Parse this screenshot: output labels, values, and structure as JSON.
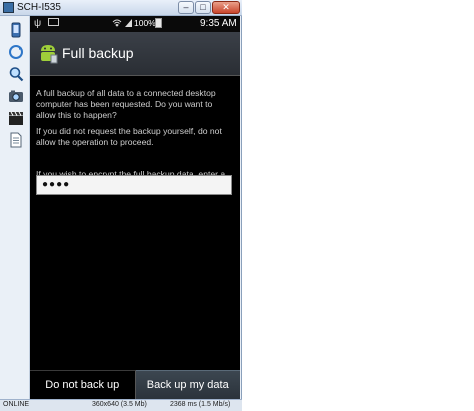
{
  "window": {
    "title": "SCH-I535",
    "minimize_label": "–",
    "maximize_label": "□",
    "close_label": "✕"
  },
  "tools": [
    {
      "name": "phone-icon"
    },
    {
      "name": "rotate-icon"
    },
    {
      "name": "zoom-icon"
    },
    {
      "name": "camera-icon"
    },
    {
      "name": "video-clapper-icon"
    },
    {
      "name": "document-icon"
    }
  ],
  "statusbar": {
    "battery_percent": "100%",
    "time": "9:35 AM"
  },
  "actionbar": {
    "title": "Full backup"
  },
  "content": {
    "paragraph1": "A full backup of all data to a connected desktop computer has been requested. Do you want to allow this to happen?",
    "paragraph2": "If you did not request the backup yourself, do not allow the operation to proceed.",
    "paragraph3": "If you wish to encrypt the full backup data, enter a password below:",
    "password_value": "●●●●"
  },
  "buttons": {
    "deny_label": "Do not back up",
    "confirm_label": "Back up my data"
  },
  "bottombar": {
    "status": "ONLINE",
    "resolution": "360x640 (3.5 Mb)",
    "timing": "2368 ms (1.5 Mb/s)"
  }
}
